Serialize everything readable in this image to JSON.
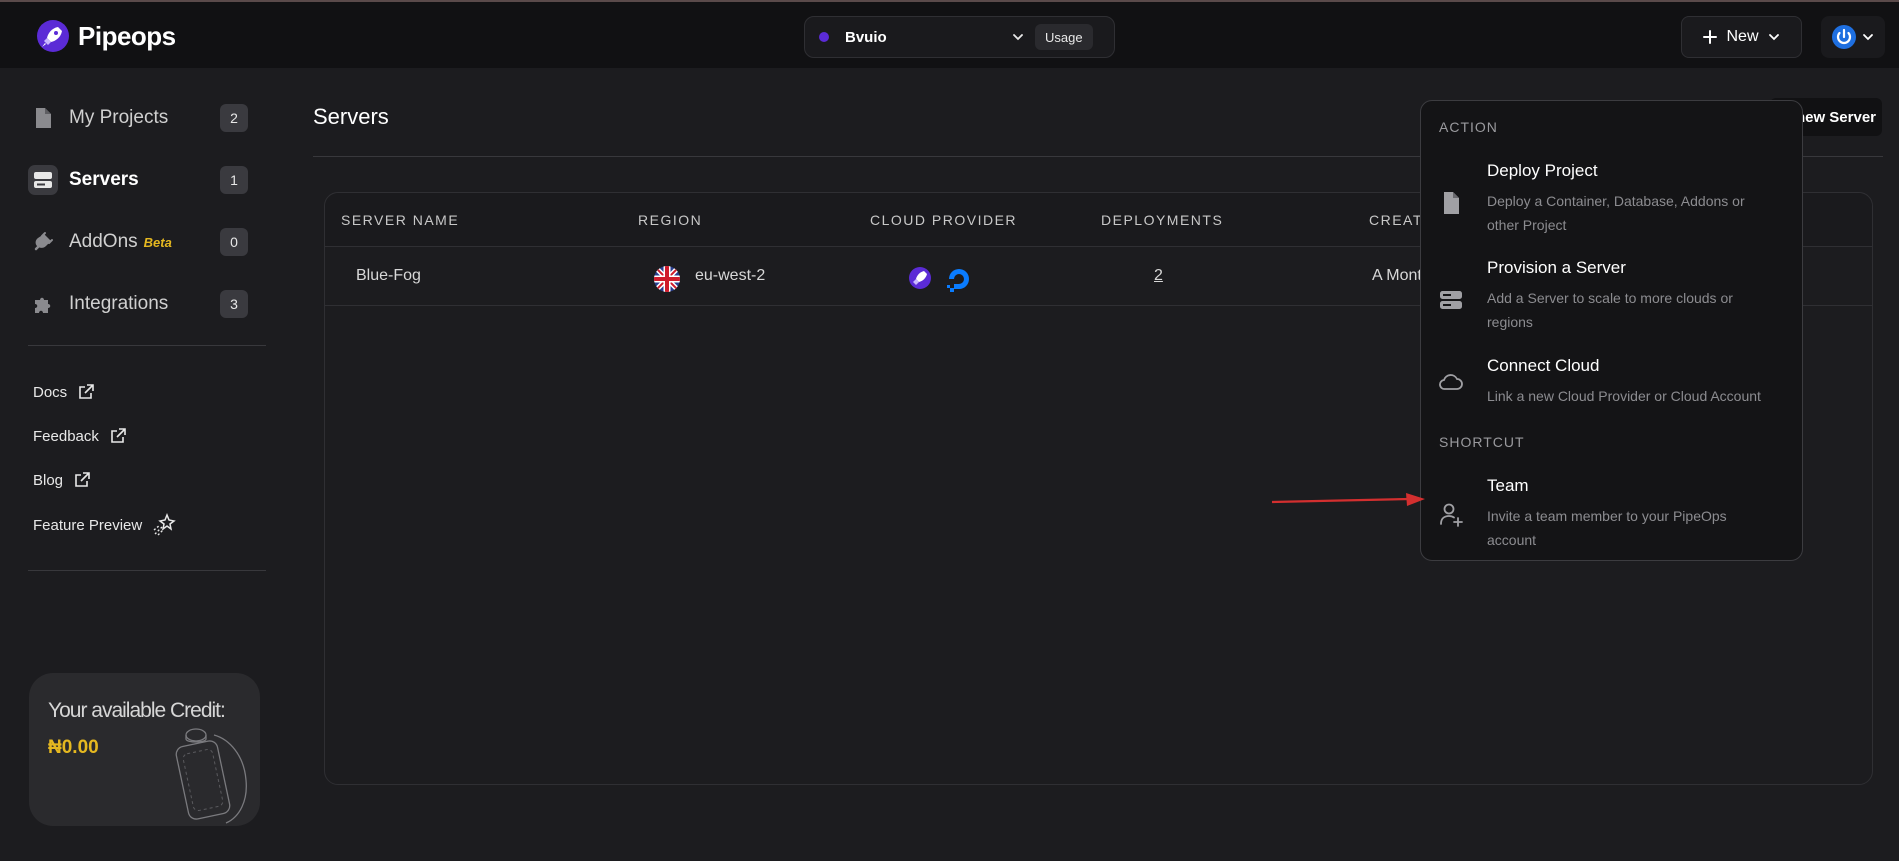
{
  "header": {
    "logo_text": "Pipeops",
    "workspace": {
      "name": "Bvuio",
      "usage_label": "Usage"
    },
    "new_button_label": "New"
  },
  "sidebar": {
    "nav": [
      {
        "label": "My Projects",
        "count": "2",
        "icon": "file-icon"
      },
      {
        "label": "Servers",
        "count": "1",
        "icon": "server-icon",
        "active": true
      },
      {
        "label": "AddOns",
        "badge": "Beta",
        "count": "0",
        "icon": "plug-icon"
      },
      {
        "label": "Integrations",
        "count": "3",
        "icon": "puzzle-icon"
      }
    ],
    "links": [
      {
        "label": "Docs",
        "icon": "external-link-icon"
      },
      {
        "label": "Feedback",
        "icon": "external-link-icon"
      },
      {
        "label": "Blog",
        "icon": "external-link-icon"
      },
      {
        "label": "Feature Preview",
        "icon": "sparkle-icon"
      }
    ],
    "credit": {
      "title": "Your available Credit:",
      "value": "₦0.00"
    }
  },
  "main": {
    "title": "Servers",
    "add_server_label": "new Server",
    "table": {
      "columns": [
        "SERVER NAME",
        "REGION",
        "CLOUD PROVIDER",
        "DEPLOYMENTS",
        "CREATE"
      ],
      "rows": [
        {
          "name": "Blue-Fog",
          "region": "eu-west-2",
          "deployments": "2",
          "created": "A Mont"
        }
      ]
    }
  },
  "menu": {
    "action_heading": "ACTION",
    "shortcut_heading": "SHORTCUT",
    "items": [
      {
        "title": "Deploy Project",
        "desc": "Deploy a Container, Database, Addons or other Project",
        "icon": "file-icon"
      },
      {
        "title": "Provision a Server",
        "desc": "Add a Server to scale to more clouds or regions",
        "icon": "server-icon"
      },
      {
        "title": "Connect Cloud",
        "desc": "Link a new Cloud Provider or Cloud Account",
        "icon": "cloud-icon"
      },
      {
        "title": "Team",
        "desc": "Invite a team member to your PipeOps account",
        "icon": "user-plus-icon"
      }
    ]
  },
  "colors": {
    "accent": "#5b2bd6",
    "credit": "#e5b820",
    "arrow": "#d32f2f"
  }
}
